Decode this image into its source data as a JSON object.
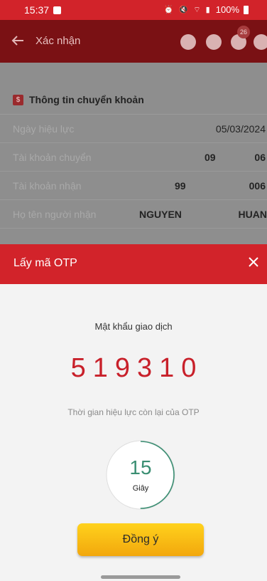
{
  "status_bar": {
    "time": "15:37",
    "battery": "100%"
  },
  "header": {
    "title": "Xác nhận",
    "notification_count": "26"
  },
  "transfer_info": {
    "section_title": "Thông tin chuyển khoản",
    "rows": [
      {
        "label": "Ngày hiệu lực",
        "value": "05/03/2024"
      },
      {
        "label": "Tài khoản chuyển",
        "value_a": "09",
        "value_b": "06"
      },
      {
        "label": "Tài khoản nhận",
        "value_a": "99",
        "value_b": "006"
      },
      {
        "label": "Họ tên người nhận",
        "value_a": "NGUYEN",
        "value_b": "HUAN"
      }
    ]
  },
  "otp_sheet": {
    "title": "Lấy mã OTP",
    "password_label": "Mật khẩu giao dịch",
    "otp_code": "519310",
    "expiry_label": "Thời gian hiệu lực còn lại của OTP",
    "timer_seconds": "15",
    "timer_unit": "Giây",
    "timer_fraction": 0.5,
    "confirm_label": "Đồng ý"
  },
  "colors": {
    "brand_red": "#d2232a",
    "otp_red": "#c8202a",
    "timer_green": "#3a8e72",
    "button_yellow": "#f7b90f"
  }
}
